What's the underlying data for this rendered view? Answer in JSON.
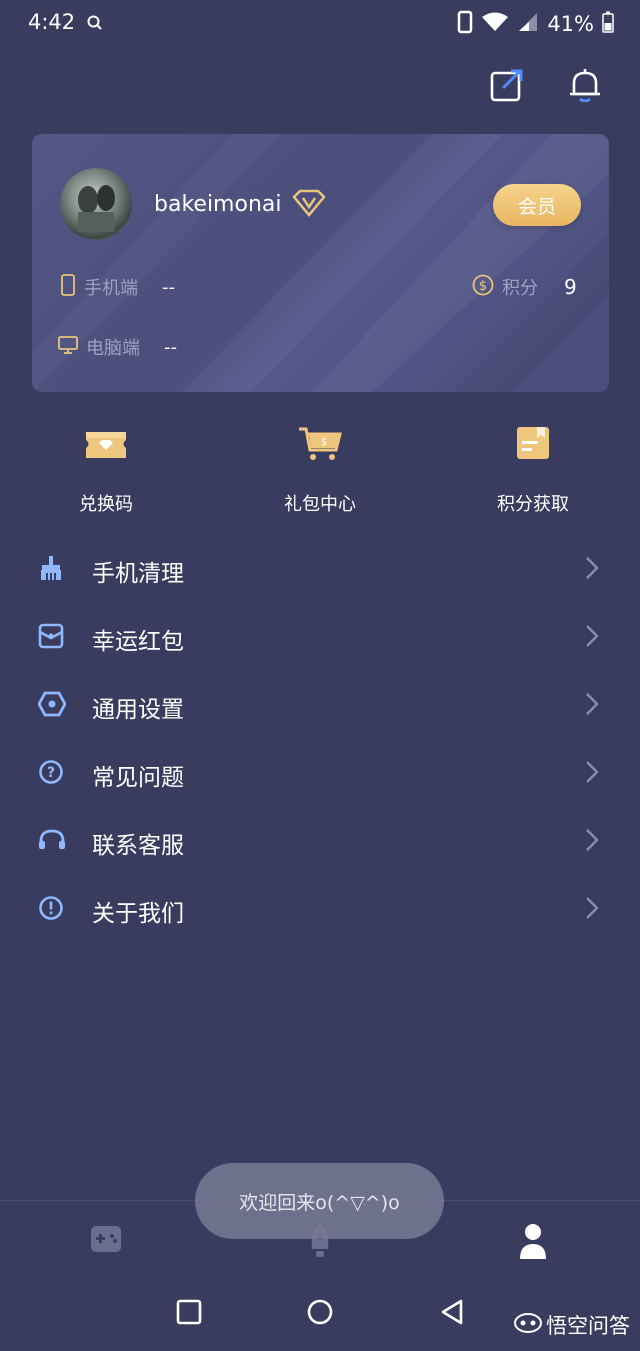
{
  "status_bar": {
    "time": "4:42",
    "battery": "41%"
  },
  "profile": {
    "username": "bakeimonai",
    "member_label": "会员",
    "mobile_label": "手机端",
    "mobile_value": "--",
    "pc_label": "电脑端",
    "pc_value": "--",
    "points_label": "积分",
    "points_value": "9"
  },
  "shortcuts": [
    {
      "label": "兑换码",
      "icon": "ticket-icon"
    },
    {
      "label": "礼包中心",
      "icon": "cart-icon"
    },
    {
      "label": "积分获取",
      "icon": "note-icon"
    }
  ],
  "menu": [
    {
      "label": "手机清理",
      "icon": "broom-icon"
    },
    {
      "label": "幸运红包",
      "icon": "red-packet-icon"
    },
    {
      "label": "通用设置",
      "icon": "settings-icon"
    },
    {
      "label": "常见问题",
      "icon": "question-icon"
    },
    {
      "label": "联系客服",
      "icon": "headset-icon"
    },
    {
      "label": "关于我们",
      "icon": "info-icon"
    }
  ],
  "toast": "欢迎回来o(^▽^)o",
  "watermark": "悟空问答",
  "colors": {
    "background": "#393c5e",
    "card": "#4f5280",
    "gold": "#e9c47a",
    "menu_icon": "#8fb8ff",
    "accent_blue": "#4f8dff"
  }
}
